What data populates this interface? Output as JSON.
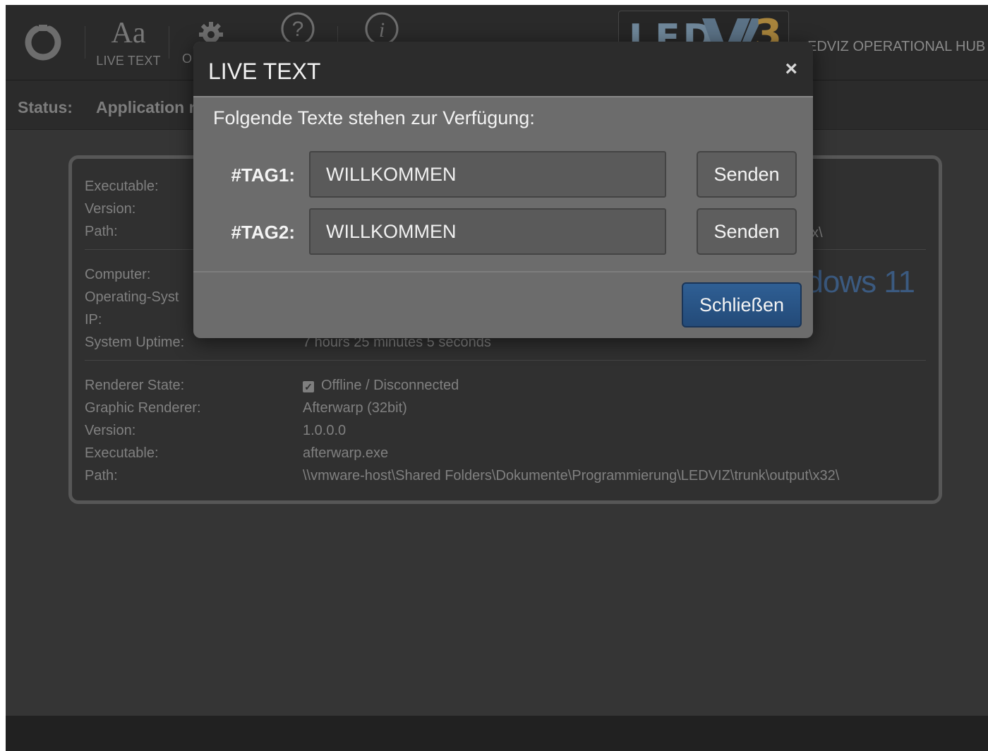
{
  "toolbar": {
    "refresh_icon": "refresh-icon",
    "live_text_glyph": "Aa",
    "live_text_label": "LIVE TEXT",
    "options_label_partial": "O",
    "settings_icon": "gear-icon",
    "help_glyph": "?",
    "info_glyph": "i",
    "logo_text": "LED",
    "logo_number": "3",
    "hub_title": "EDVIZ OPERATIONAL HUB"
  },
  "status": {
    "key": "Status:",
    "value": "Application r"
  },
  "panel": {
    "app_rows": [
      "Executable:",
      "Version:",
      "Path:"
    ],
    "app_path_tail": "x\\",
    "system_rows": [
      "Computer:",
      "Operating-Syst",
      "IP:",
      "System Uptime:"
    ],
    "uptime_value": "7 hours 25 minutes 5 seconds",
    "os_logo_text": "dows 11",
    "renderer_rows": [
      "Renderer State:",
      "Graphic Renderer:",
      "Version:",
      "Executable:",
      "Path:"
    ],
    "renderer_values": [
      "Offline / Disconnected",
      "Afterwarp (32bit)",
      "1.0.0.0",
      "afterwarp.exe",
      "\\\\vmware-host\\Shared Folders\\Dokumente\\Programmierung\\LEDVIZ\\trunk\\output\\x32\\"
    ]
  },
  "modal": {
    "title": "LIVE TEXT",
    "close_glyph": "×",
    "intro": "Folgende Texte stehen zur Verfügung:",
    "tags": [
      {
        "label": "#TAG1:",
        "value": "WILLKOMMEN",
        "button": "Senden"
      },
      {
        "label": "#TAG2:",
        "value": "WILLKOMMEN",
        "button": "Senden"
      }
    ],
    "close_button": "Schließen"
  },
  "colors": {
    "background": "#353535",
    "toolbar": "#2a2a2a",
    "modal_body": "#6c6c6c",
    "modal_header": "#2c2c2c",
    "primary_button": "#2f5f94",
    "logo_accent": "#a8843c"
  }
}
